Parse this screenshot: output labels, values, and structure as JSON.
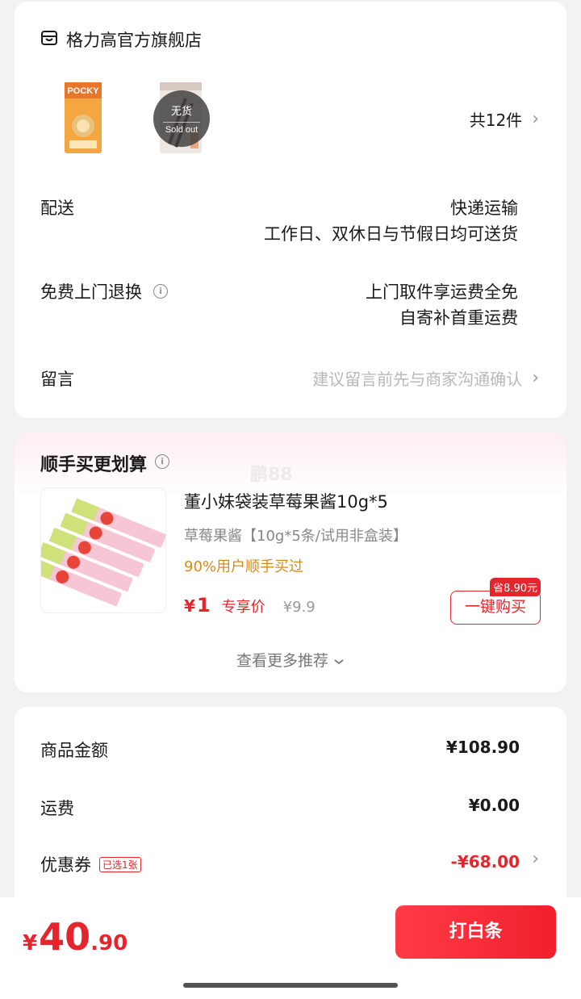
{
  "shop": {
    "icon": "store-icon",
    "name": "格力高官方旗舰店",
    "soldout_cn": "无货",
    "soldout_en": "Sold out",
    "item_count": "共12件",
    "delivery_label": "配送",
    "delivery_value": "快递运输",
    "delivery_note": "工作日、双休日与节假日均可送货",
    "return_label": "免费上门退换",
    "return_value1": "上门取件享运费全免",
    "return_value2": "自寄补首重运费",
    "message_label": "留言",
    "message_placeholder": "建议留言前先与商家沟通确认"
  },
  "recommend": {
    "title": "顺手买更划算",
    "watermark": "鹏88",
    "product_name": "董小妹袋装草莓果酱10g*5",
    "product_spec": "草莓果酱【10g*5条/试用非盒装】",
    "product_hot": "90%用户顺手买过",
    "price_symbol": "¥",
    "price_value": "1",
    "price_tag": "专享价",
    "old_price": "¥9.9",
    "save_badge": "省8.90元",
    "buy_label": "一键购买",
    "more_label": "查看更多推荐"
  },
  "summary": {
    "goods_label": "商品金额",
    "goods_value": "¥108.90",
    "shipping_label": "运费",
    "shipping_value": "¥0.00",
    "coupon_label": "优惠券",
    "coupon_badge": "已选1张",
    "coupon_value": "-¥68.00"
  },
  "footer": {
    "total_symbol": "¥",
    "total_int": "40",
    "total_dec": ".90",
    "pay_label": "打白条"
  },
  "colors": {
    "accent": "#e5252c",
    "hot": "#d98a1a",
    "background": "#f2f2f2"
  }
}
